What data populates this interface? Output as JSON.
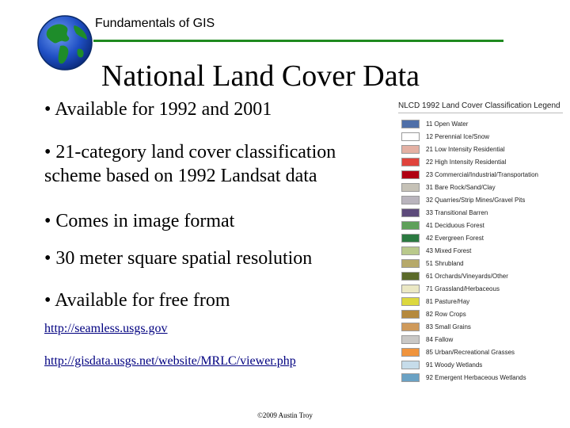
{
  "header": {
    "title": "Fundamentals of GIS"
  },
  "slide": {
    "title": "National Land Cover Data",
    "bullets": [
      "• Available for 1992 and 2001",
      "• 21-category land cover classification scheme based on 1992 Landsat data",
      "• Comes in image format",
      "• 30 meter square spatial resolution",
      "• Available for free from"
    ],
    "links": [
      "http://seamless.usgs.gov",
      "http://gisdata.usgs.net/website/MRLC/viewer.php"
    ],
    "footer": "©2009 Austin Troy"
  },
  "legend": {
    "title": "NLCD 1992 Land Cover Classification Legend",
    "items": [
      {
        "label": "11 Open Water",
        "color": "#4f6fa8"
      },
      {
        "label": "12 Perennial Ice/Snow",
        "color": "#ffffff"
      },
      {
        "label": "21 Low Intensity Residential",
        "color": "#e4b1a4"
      },
      {
        "label": "22 High Intensity Residential",
        "color": "#e0433c"
      },
      {
        "label": "23 Commercial/Industrial/Transportation",
        "color": "#b00012"
      },
      {
        "label": "31 Bare Rock/Sand/Clay",
        "color": "#c6c2b7"
      },
      {
        "label": "32 Quarries/Strip Mines/Gravel Pits",
        "color": "#b9b4bd"
      },
      {
        "label": "33 Transitional Barren",
        "color": "#5c4a7a"
      },
      {
        "label": "41 Deciduous Forest",
        "color": "#5fa05a"
      },
      {
        "label": "42 Evergreen Forest",
        "color": "#2b7a41"
      },
      {
        "label": "43 Mixed Forest",
        "color": "#b9c98c"
      },
      {
        "label": "51 Shrubland",
        "color": "#b6a96a"
      },
      {
        "label": "61 Orchards/Vineyards/Other",
        "color": "#5b6a2a"
      },
      {
        "label": "71 Grassland/Herbaceous",
        "color": "#ebe8c4"
      },
      {
        "label": "81 Pasture/Hay",
        "color": "#dcd83e"
      },
      {
        "label": "82 Row Crops",
        "color": "#b5893d"
      },
      {
        "label": "83 Small Grains",
        "color": "#cf9a5b"
      },
      {
        "label": "84 Fallow",
        "color": "#c9c8c6"
      },
      {
        "label": "85 Urban/Recreational Grasses",
        "color": "#f0943d"
      },
      {
        "label": "91 Woody Wetlands",
        "color": "#c6dcea"
      },
      {
        "label": "92 Emergent Herbaceous Wetlands",
        "color": "#6aa2c4"
      }
    ]
  }
}
